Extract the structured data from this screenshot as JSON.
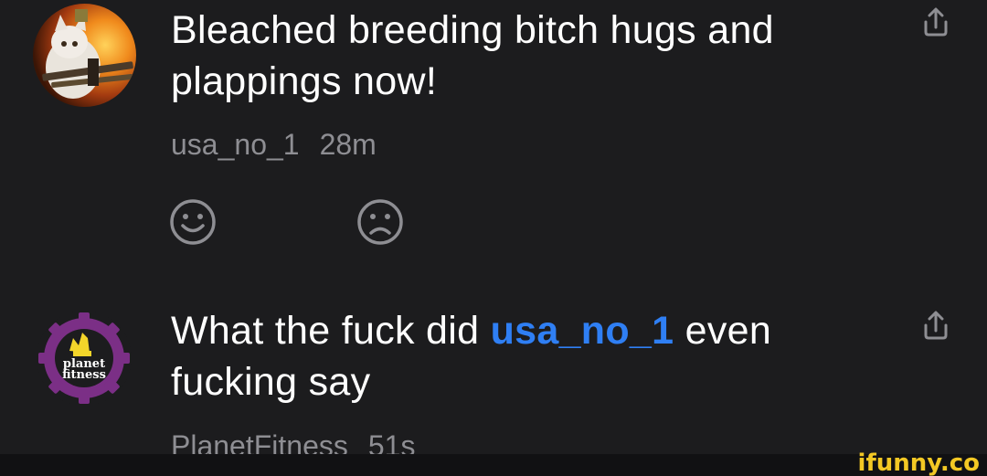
{
  "comments": [
    {
      "avatar_icon": "cat-with-guns-avatar",
      "text": "Bleached breeding bitch hugs and plappings now!",
      "username": "usa_no_1",
      "time": "28m"
    },
    {
      "avatar_icon": "planet-fitness-logo-avatar",
      "avatar_text_line1": "planet",
      "avatar_text_line2": "fitness",
      "text_before": "What the fuck did ",
      "mention": "usa_no_1",
      "text_after": " even fucking say",
      "username": "PlanetFitness",
      "time": "51s"
    }
  ],
  "reactions": {
    "happy_icon": "smile-icon",
    "sad_icon": "frown-icon"
  },
  "share_icon": "share-icon",
  "watermark": "ifunny.co",
  "colors": {
    "background": "#1c1c1e",
    "text": "#ffffff",
    "meta": "#8e8e93",
    "mention": "#2f7ff4",
    "watermark": "#f3c824",
    "avatar_purple": "#7b2f86"
  }
}
